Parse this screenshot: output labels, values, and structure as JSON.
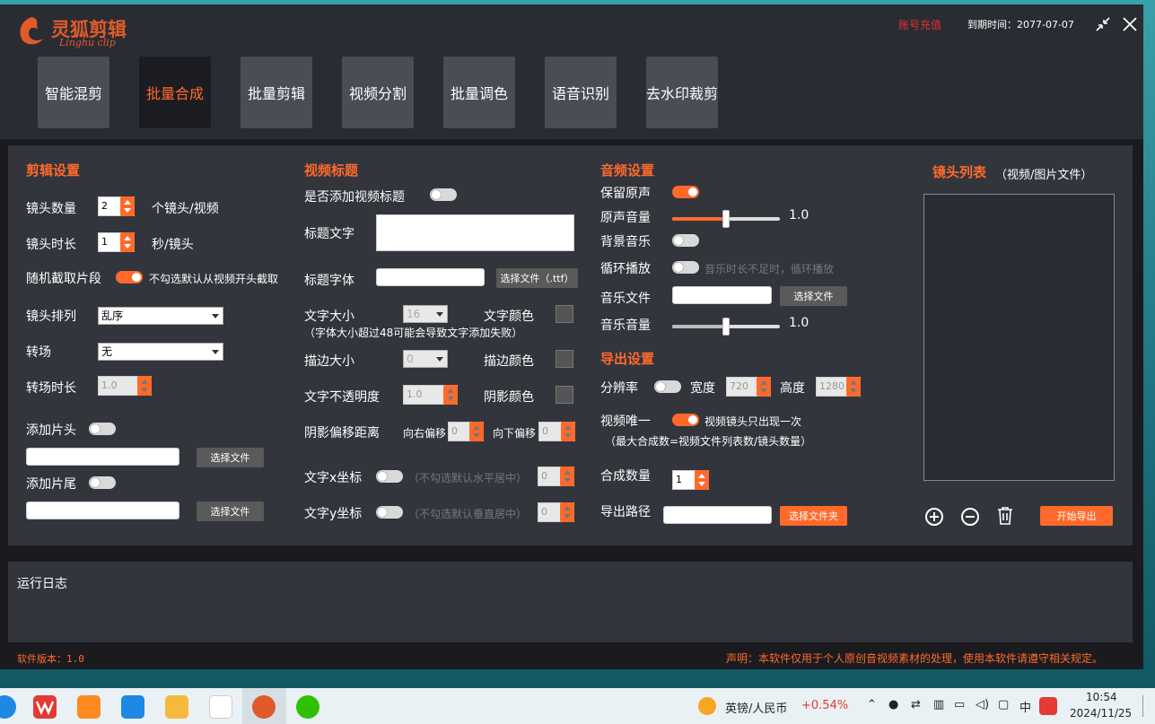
{
  "app": {
    "logo_cn": "灵狐剪辑",
    "logo_en": "Linghu clip",
    "recharge": "账号充值",
    "expiry": "到期时间：2077-07-07",
    "colors": {
      "accent": "#ff6a2a",
      "bg": "#1b1b1f",
      "panel": "#33353d",
      "header": "#2a2c33"
    }
  },
  "tabs": [
    {
      "label": "智能混剪"
    },
    {
      "label": "批量合成"
    },
    {
      "label": "批量剪辑"
    },
    {
      "label": "视频分割"
    },
    {
      "label": "批量调色"
    },
    {
      "label": "语音识别"
    },
    {
      "label": "去水印裁剪"
    }
  ],
  "edit": {
    "title": "剪辑设置",
    "shot_count_label": "镜头数量",
    "shot_count": "2",
    "shot_count_unit": "个镜头/视频",
    "shot_duration_label": "镜头时长",
    "shot_duration": "1",
    "shot_duration_unit": "秒/镜头",
    "random_label": "随机截取片段",
    "random_hint": "不勾选默认从视频开头截取",
    "order_label": "镜头排列",
    "order_value": "乱序",
    "transition_label": "转场",
    "transition_value": "无",
    "transition_duration_label": "转场时长",
    "transition_duration": "1.0",
    "intro_label": "添加片头",
    "outro_label": "添加片尾",
    "choose_file": "选择文件"
  },
  "title_section": {
    "title": "视频标题",
    "add_label": "是否添加视频标题",
    "text_label": "标题文字",
    "font_label": "标题字体",
    "font_button": "选择文件（.ttf）",
    "size_label": "文字大小",
    "size_value": "16",
    "color_label": "文字颜色",
    "size_hint": "（字体大小超过48可能会导致文字添加失败）",
    "stroke_label": "描边大小",
    "stroke_value": "0",
    "stroke_color_label": "描边颜色",
    "opacity_label": "文字不透明度",
    "opacity_value": "1.0",
    "shadow_color_label": "阴影颜色",
    "shadow_offset_label": "阴影偏移距离",
    "offset_right_label": "向右偏移",
    "offset_right_value": "0",
    "offset_down_label": "向下偏移",
    "offset_down_value": "0",
    "x_label": "文字x坐标",
    "x_hint": "（不勾选默认水平居中）",
    "x_value": "0",
    "y_label": "文字y坐标",
    "y_hint": "（不勾选默认垂直居中）",
    "y_value": "0"
  },
  "audio": {
    "title": "音频设置",
    "keep_label": "保留原声",
    "orig_volume_label": "原声音量",
    "orig_volume": "1.0",
    "orig_volume_level": 0.5,
    "bgm_label": "背景音乐",
    "loop_label": "循环播放",
    "loop_hint": "音乐时长不足时，循环播放",
    "music_file_label": "音乐文件",
    "choose_file": "选择文件",
    "music_volume_label": "音乐音量",
    "music_volume": "1.0",
    "music_volume_level": 0.5
  },
  "export": {
    "title": "导出设置",
    "resolution_label": "分辨率",
    "width_label": "宽度",
    "width_value": "720",
    "height_label": "高度",
    "height_value": "1280",
    "unique_label": "视频唯一",
    "unique_hint": "视频镜头只出现一次",
    "unique_hint2": "（最大合成数=视频文件列表数/镜头数量）",
    "count_label": "合成数量",
    "count_value": "1",
    "path_label": "导出路径",
    "choose_folder": "选择文件夹"
  },
  "shots": {
    "title": "镜头列表",
    "subtitle": "（视频/图片文件）",
    "start_export": "开始导出"
  },
  "log": {
    "title": "运行日志"
  },
  "footer": {
    "version": "软件版本：1.0",
    "notice": "声明：本软件仅用于个人原创音视频素材的处理，使用本软件请遵守相关规定。"
  },
  "taskbar": {
    "stock": "英镑/人民币",
    "stock_change": "+0.54%",
    "ime": "中",
    "time": "10:54",
    "date": "2024/11/25"
  }
}
